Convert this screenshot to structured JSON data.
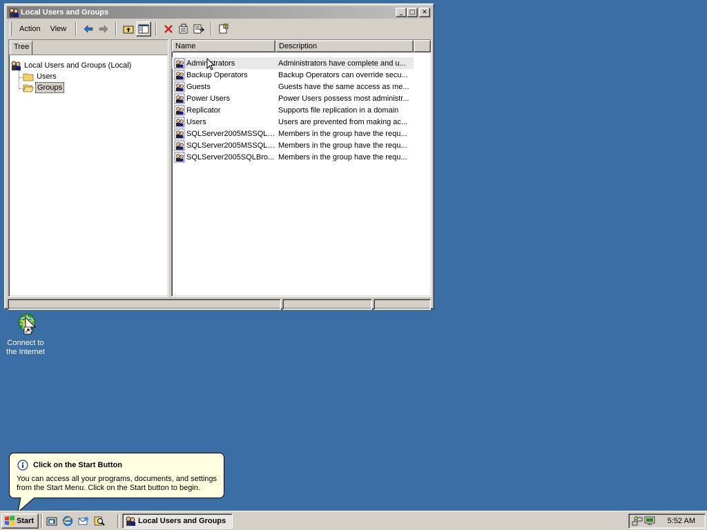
{
  "window": {
    "title": "Local Users and Groups",
    "minimize": "_",
    "maximize": "□",
    "close": "✕"
  },
  "menu": {
    "action": "Action",
    "view": "View"
  },
  "tree": {
    "tab_label": "Tree",
    "root_label": "Local Users and Groups (Local)",
    "children": [
      {
        "label": "Users"
      },
      {
        "label": "Groups"
      }
    ]
  },
  "list": {
    "columns": [
      "Name",
      "Description"
    ],
    "rows": [
      {
        "name": "Administrators",
        "description": "Administrators have complete and u..."
      },
      {
        "name": "Backup Operators",
        "description": "Backup Operators can override secu..."
      },
      {
        "name": "Guests",
        "description": "Guests have the same access as me..."
      },
      {
        "name": "Power Users",
        "description": "Power Users possess most administr..."
      },
      {
        "name": "Replicator",
        "description": "Supports file replication in a domain"
      },
      {
        "name": "Users",
        "description": "Users are prevented from making ac..."
      },
      {
        "name": "SQLServer2005MSSQLS...",
        "description": "Members in the group have the requ..."
      },
      {
        "name": "SQLServer2005MSSQLU...",
        "description": "Members in the group have the requ..."
      },
      {
        "name": "SQLServer2005SQLBro...",
        "description": "Members in the group have the requ..."
      }
    ]
  },
  "desktop": {
    "icon_label_line1": "Connect to",
    "icon_label_line2": "the Internet"
  },
  "balloon": {
    "title": "Click on the Start Button",
    "body": "You can access all your programs, documents, and settings from the Start Menu. Click on the Start button to begin."
  },
  "taskbar": {
    "start_label": "Start",
    "task_label": "Local Users and Groups",
    "clock": "5:52 AM"
  }
}
